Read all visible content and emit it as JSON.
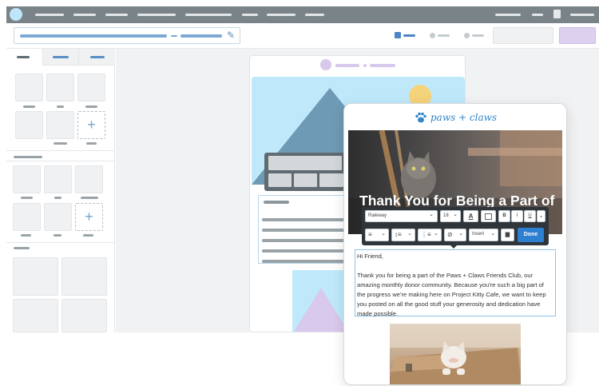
{
  "editor": {
    "logo_brand": "paws + claws",
    "hero_headline": "Thank You for Being a Part of",
    "toolbar": {
      "font_name": "Raleway",
      "font_size": "18",
      "bold": "B",
      "italic": "I",
      "underline": "U",
      "insert_label": "Insert",
      "done_label": "Done"
    },
    "body_greeting": "Hi Friend,",
    "body_paragraph": "Thank you for being a part of the Paws + Claws Friends Club, our amazing monthly donor community. Because you're such a big part of the progress we're making here on Project Kitty Cafe, we want to keep you posted on all the good stuff your generosity and dedication have made possible."
  },
  "icons": {
    "plus": "+",
    "chevron": "⌄",
    "pencil": "✎",
    "trash": "🗑",
    "paw": "🐾"
  },
  "colors": {
    "nav_gray": "#7a8388",
    "accent_blue": "#2d7fd0",
    "sky": "#bfe9fb",
    "mountain": "#6f9ab5",
    "sun": "#f5d37b",
    "lavender": "#d9c9ec"
  }
}
